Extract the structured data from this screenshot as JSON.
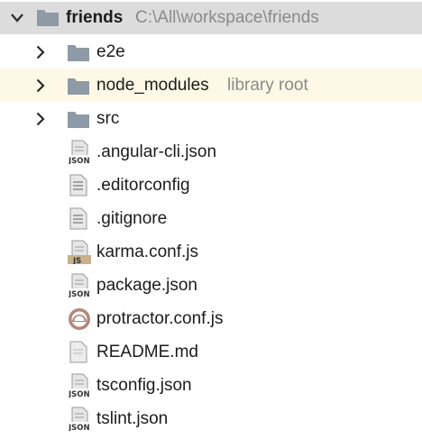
{
  "root": {
    "name": "friends",
    "path": "C:\\All\\workspace\\friends"
  },
  "items": [
    {
      "name": "e2e",
      "kind": "folder",
      "expandable": true,
      "hint": ""
    },
    {
      "name": "node_modules",
      "kind": "folder",
      "expandable": true,
      "hint": "library root",
      "highlighted": true
    },
    {
      "name": "src",
      "kind": "folder",
      "expandable": true,
      "hint": ""
    },
    {
      "name": ".angular-cli.json",
      "kind": "json-file",
      "icon_text": "JSON"
    },
    {
      "name": ".editorconfig",
      "kind": "text-file"
    },
    {
      "name": ".gitignore",
      "kind": "text-file"
    },
    {
      "name": "karma.conf.js",
      "kind": "js-file",
      "icon_text": "JS"
    },
    {
      "name": "package.json",
      "kind": "json-file",
      "icon_text": "JSON"
    },
    {
      "name": "protractor.conf.js",
      "kind": "protractor-file"
    },
    {
      "name": "README.md",
      "kind": "markdown-file"
    },
    {
      "name": "tsconfig.json",
      "kind": "json-file",
      "icon_text": "JSON"
    },
    {
      "name": "tslint.json",
      "kind": "json-file",
      "icon_text": "JSON"
    }
  ],
  "colors": {
    "folder": "#8e9aa6",
    "selection": "#dcdcdc",
    "highlight": "#fdf9e6",
    "hint": "#8a8a8a"
  }
}
